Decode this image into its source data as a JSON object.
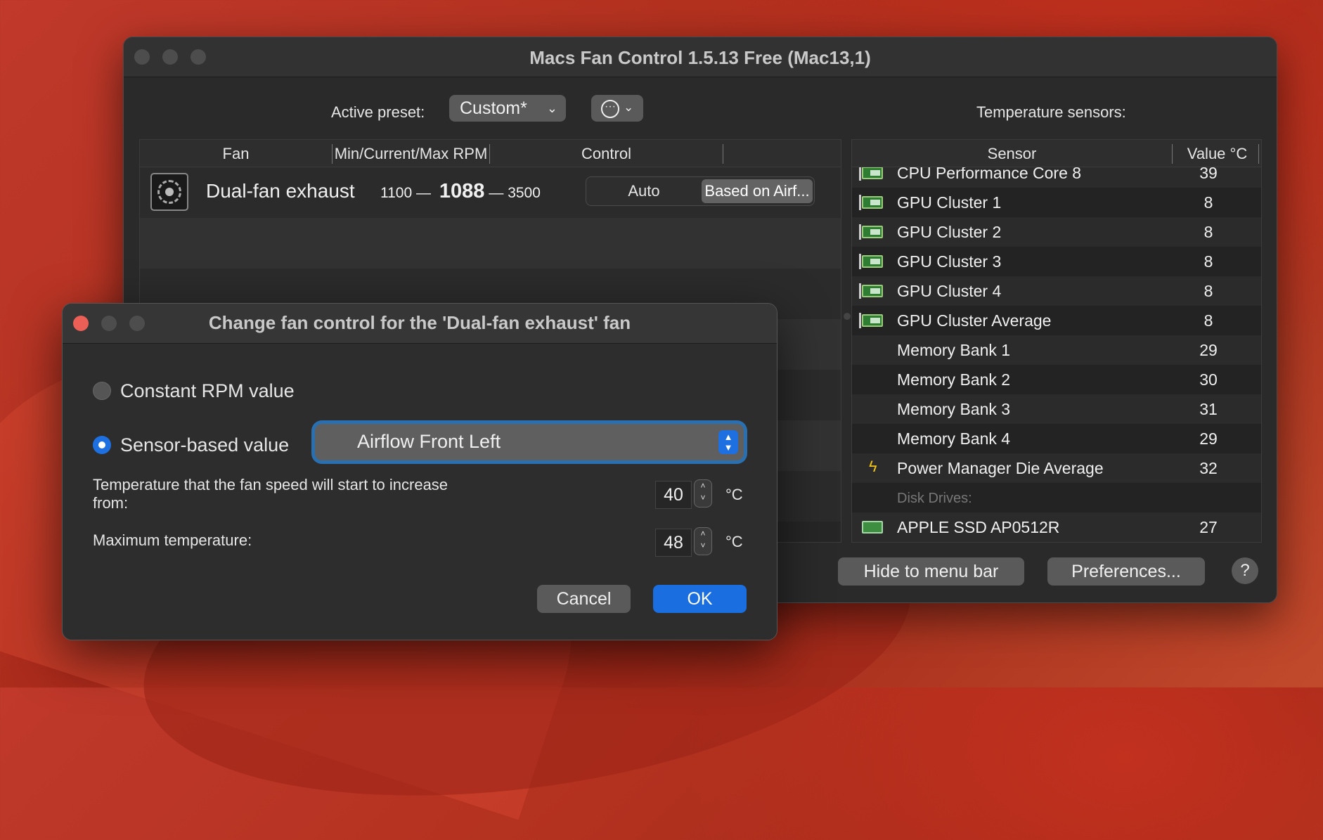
{
  "window": {
    "title": "Macs Fan Control 1.5.13 Free (Mac13,1)",
    "active_preset_label": "Active preset:",
    "active_preset_value": "Custom*",
    "temp_sensors_label": "Temperature sensors:"
  },
  "fan_table": {
    "columns": [
      "Fan",
      "Min/Current/Max RPM",
      "Control"
    ],
    "rows": [
      {
        "name": "Dual-fan exhaust",
        "min": "1100",
        "current": "1088",
        "max": "3500",
        "control_auto": "Auto",
        "control_selected": "Based on Airf..."
      }
    ]
  },
  "sensor_table": {
    "columns": [
      "Sensor",
      "Value °C"
    ],
    "rows": [
      {
        "icon": "chip-icon",
        "name": "CPU Performance Core 8",
        "value": "39"
      },
      {
        "icon": "chip-icon",
        "name": "GPU Cluster 1",
        "value": "8"
      },
      {
        "icon": "chip-icon",
        "name": "GPU Cluster 2",
        "value": "8"
      },
      {
        "icon": "chip-icon",
        "name": "GPU Cluster 3",
        "value": "8"
      },
      {
        "icon": "chip-icon",
        "name": "GPU Cluster 4",
        "value": "8"
      },
      {
        "icon": "chip-icon",
        "name": "GPU Cluster Average",
        "value": "8"
      },
      {
        "icon": "",
        "name": "Memory Bank 1",
        "value": "29"
      },
      {
        "icon": "",
        "name": "Memory Bank 2",
        "value": "30"
      },
      {
        "icon": "",
        "name": "Memory Bank 3",
        "value": "31"
      },
      {
        "icon": "",
        "name": "Memory Bank 4",
        "value": "29"
      },
      {
        "icon": "bolt-icon",
        "name": "Power Manager Die Average",
        "value": "32"
      },
      {
        "group": true,
        "name": "Disk Drives:",
        "value": ""
      },
      {
        "icon": "ssd-icon",
        "name": "APPLE SSD AP0512R",
        "value": "27"
      }
    ]
  },
  "bottom_buttons": {
    "hide": "Hide to menu bar",
    "preferences": "Preferences...",
    "help": "?"
  },
  "dialog": {
    "title": "Change fan control for the 'Dual-fan exhaust' fan",
    "option_constant": "Constant RPM value",
    "option_sensor": "Sensor-based value",
    "selected_option": "sensor",
    "sensor_select_value": "Airflow Front Left",
    "start_temp_label": "Temperature that the fan speed will start to increase from:",
    "start_temp_value": "40",
    "max_temp_label": "Maximum temperature:",
    "max_temp_value": "48",
    "unit": "°C",
    "cancel_label": "Cancel",
    "ok_label": "OK"
  },
  "colors": {
    "accent": "#1a6ee0",
    "close_button": "#ec5f56",
    "chip_green": "#2f7d32"
  }
}
